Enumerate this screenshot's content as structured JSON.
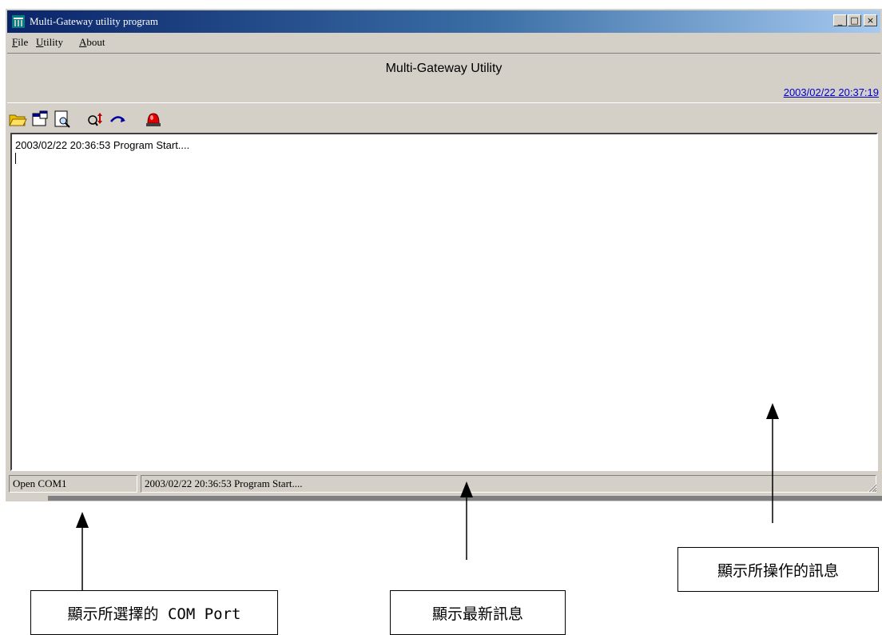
{
  "window": {
    "title": "Multi-Gateway utility program",
    "buttons": {
      "minimize": "_",
      "maximize": "□",
      "close": "×"
    }
  },
  "menu": [
    {
      "label": "File",
      "accel": "F",
      "rest": "ile"
    },
    {
      "label": "Utility",
      "accel": "U",
      "rest": "tility"
    },
    {
      "label": "About",
      "accel": "A",
      "rest": "bout"
    }
  ],
  "header": {
    "title": "Multi-Gateway Utility",
    "clock": "2003/02/22 20:37:19"
  },
  "toolbar": {
    "icons": [
      "open-folder-icon",
      "properties-icon",
      "print-preview-icon",
      "search-swap-icon",
      "redo-arrow-icon",
      "alarm-light-icon"
    ]
  },
  "log": {
    "lines": [
      "2003/02/22 20:36:53  Program Start...."
    ]
  },
  "statusbar": {
    "com": "Open COM1",
    "latest": "2003/02/22 20:36:53  Program Start...."
  },
  "annotations": {
    "com_port": "顯示所選擇的 COM Port",
    "latest_message": "顯示最新訊息",
    "operation_messages": "顯示所操作的訊息"
  },
  "colors": {
    "titlebar_start": "#0a246a",
    "titlebar_end": "#a6caf0",
    "clock": "#0000cc",
    "chrome": "#d4d0c8"
  }
}
